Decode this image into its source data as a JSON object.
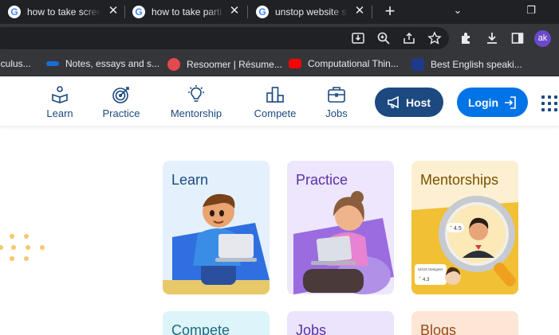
{
  "browser": {
    "tabs": [
      {
        "title": "how to take scree"
      },
      {
        "title": "how to take parti"
      },
      {
        "title": "unstop website s"
      }
    ],
    "new_tab": "+",
    "profile_initials": "ak",
    "bookmarks": [
      {
        "label": "lculus..."
      },
      {
        "label": "Notes, essays and s..."
      },
      {
        "label": "Resoomer | Résume..."
      },
      {
        "label": "Computational Thin..."
      },
      {
        "label": "Best English speaki..."
      }
    ]
  },
  "nav": {
    "items": [
      {
        "label": "Learn",
        "icon": "learn-icon"
      },
      {
        "label": "Practice",
        "icon": "target-icon"
      },
      {
        "label": "Mentorship",
        "icon": "bulb-icon"
      },
      {
        "label": "Compete",
        "icon": "podium-icon"
      },
      {
        "label": "Jobs",
        "icon": "briefcase-icon"
      }
    ],
    "host_label": "Host",
    "login_label": "Login"
  },
  "cards": [
    {
      "title": "Learn",
      "bg": "#e4f1fd",
      "title_color": "#1c4980"
    },
    {
      "title": "Practice",
      "bg": "#ede6fc",
      "title_color": "#5b2fa8"
    },
    {
      "title": "Mentorships",
      "bg": "#fdf0d2",
      "title_color": "#7a5000"
    }
  ],
  "mentor_card": {
    "rating_top": "4.5",
    "rating_bottom": "4.3",
    "tag": "UI/UX Designer"
  },
  "cards_below": [
    {
      "title": "Compete",
      "bg": "#ddf4fb",
      "title_color": "#1c6a7e"
    },
    {
      "title": "Jobs",
      "bg": "#ebe4fc",
      "title_color": "#5b2fa8"
    },
    {
      "title": "Blogs",
      "bg": "#fde6d6",
      "title_color": "#9a4a1a"
    }
  ],
  "colors": {
    "brand": "#1c4980",
    "accent": "#0073e6",
    "dots": "#f6c86b"
  }
}
